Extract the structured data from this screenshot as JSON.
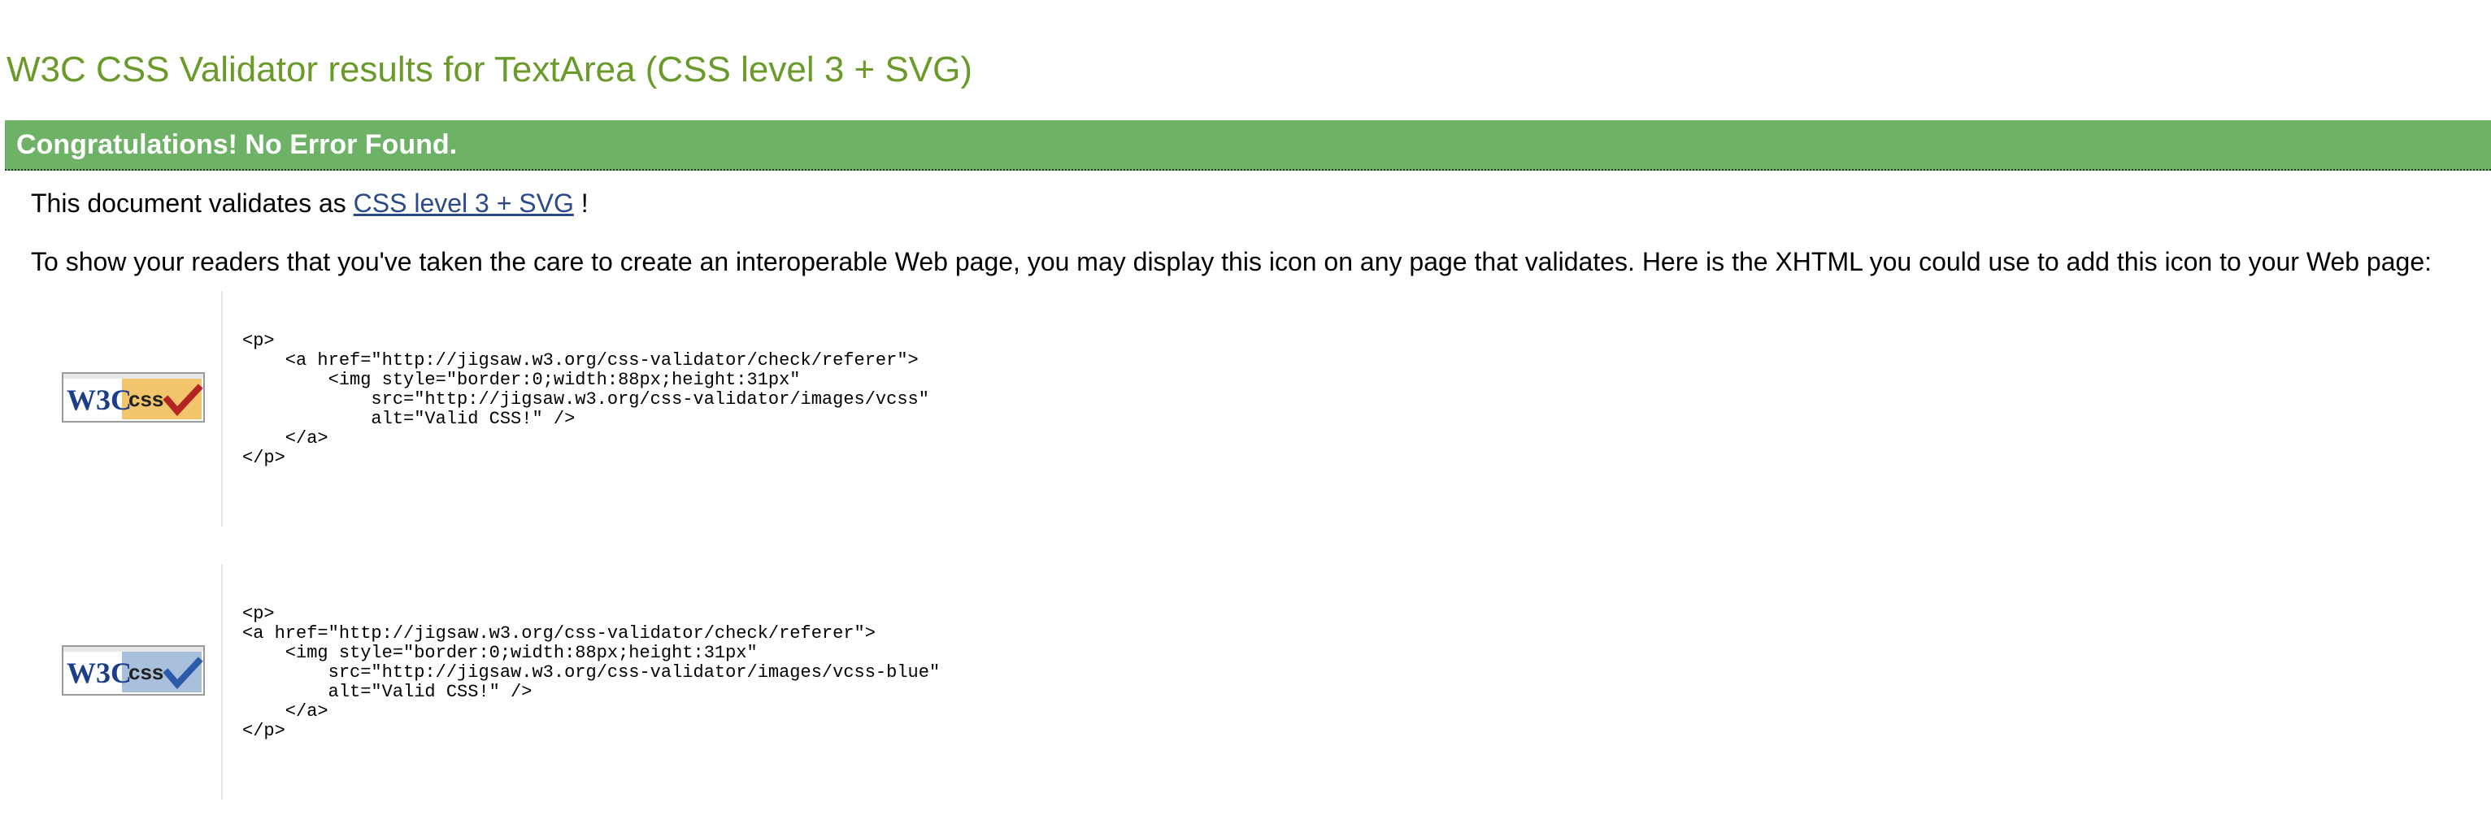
{
  "page": {
    "title": "W3C CSS Validator results for TextArea (CSS level 3 + SVG)"
  },
  "result": {
    "congrats": "Congratulations! No Error Found.",
    "validates_prefix": "This document validates as ",
    "validates_link": "CSS level 3 + SVG",
    "validates_suffix": " !",
    "intro": "To show your readers that you've taken the care to create an interoperable Web page, you may display this icon on any page that validates. Here is the XHTML you could use to add this icon to your Web page:"
  },
  "badges": [
    {
      "icon": "valid-css-gold-badge",
      "logo_text": "W3C",
      "label_text": "css",
      "accent": "#f2c46b",
      "check_color": "#b42424",
      "code": "<p>\n    <a href=\"http://jigsaw.w3.org/css-validator/check/referer\">\n        <img style=\"border:0;width:88px;height:31px\"\n            src=\"http://jigsaw.w3.org/css-validator/images/vcss\"\n            alt=\"Valid CSS!\" />\n    </a>\n</p>"
    },
    {
      "icon": "valid-css-blue-badge",
      "logo_text": "W3C",
      "label_text": "css",
      "accent": "#a9c0dc",
      "check_color": "#2a5aa8",
      "code": "<p>\n<a href=\"http://jigsaw.w3.org/css-validator/check/referer\">\n    <img style=\"border:0;width:88px;height:31px\"\n        src=\"http://jigsaw.w3.org/css-validator/images/vcss-blue\"\n        alt=\"Valid CSS!\" />\n    </a>\n</p>"
    }
  ],
  "colors": {
    "title": "#6a9a2a",
    "congrats_bar": "#6db266",
    "link": "#2a4a8a"
  }
}
